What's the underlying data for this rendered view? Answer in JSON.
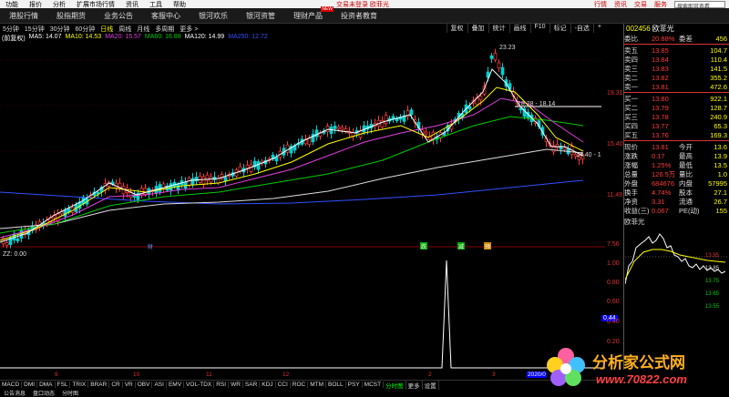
{
  "menubar": {
    "items": [
      "功能",
      "报价",
      "分析",
      "扩展市场行情",
      "资讯",
      "工具",
      "帮助"
    ],
    "warn": "交易未登录 欧菲光",
    "right": [
      "行情",
      "资讯",
      "交易",
      "服务"
    ],
    "search_placeholder": "搜索即可查看"
  },
  "nav": {
    "tabs": [
      "港股行情",
      "股指期货",
      "业务公告",
      "客服中心",
      "银河欢乐",
      "银河资管",
      "理财产品",
      "投资者教育"
    ],
    "new_badge": "NEW"
  },
  "period": {
    "items": [
      "5分钟",
      "15分钟",
      "30分钟",
      "60分钟",
      "日线",
      "周线",
      "月线",
      "多周期",
      "更多 >"
    ],
    "active": "日线",
    "right": [
      "复权",
      "叠加",
      "统计",
      "画线",
      "F10",
      "标记",
      "-自选",
      "+"
    ]
  },
  "ma": {
    "prefix": "(前复权)",
    "ma5": "MA5: 14.07",
    "ma10": "MA10: 14.53",
    "ma20": "MA20: 15.57",
    "ma60": "MA60: 16.88",
    "ma120": "MA120: 14.99",
    "ma250": "MA250: 12.72"
  },
  "chart_annotations": {
    "high": "23.23",
    "mid": "18.28 - 18.14",
    "last": "14.40 - 1",
    "zz": "ZZ: 0.00",
    "markers": [
      "财",
      "跌",
      "减",
      "预"
    ]
  },
  "yaxis": {
    "labels": [
      "19.31",
      "15.40",
      "11.49",
      "7.56",
      "1.00",
      "0.80",
      "0.60",
      "0.44",
      "0.40",
      "0.20"
    ]
  },
  "xaxis": {
    "labels": [
      "9",
      "10",
      "11",
      "12",
      "2",
      "3",
      "2020/0"
    ]
  },
  "quote": {
    "code": "002456",
    "name": "欧菲光",
    "weibi": {
      "label": "委比",
      "value": "20.88%",
      "label2": "委差",
      "value2": "456"
    },
    "asks": [
      {
        "l": "卖五",
        "p": "13.85",
        "v": "104.7"
      },
      {
        "l": "卖四",
        "p": "13.84",
        "v": "110.4"
      },
      {
        "l": "卖三",
        "p": "13.83",
        "v": "141.5"
      },
      {
        "l": "卖二",
        "p": "13.82",
        "v": "355.2"
      },
      {
        "l": "卖一",
        "p": "13.81",
        "v": "472.6"
      }
    ],
    "bids": [
      {
        "l": "买一",
        "p": "13.80",
        "v": "922.1"
      },
      {
        "l": "买二",
        "p": "13.79",
        "v": "128.7"
      },
      {
        "l": "买三",
        "p": "13.78",
        "v": "240.9"
      },
      {
        "l": "买四",
        "p": "13.77",
        "v": "65.3"
      },
      {
        "l": "买五",
        "p": "13.76",
        "v": "169.3"
      }
    ],
    "stats": [
      {
        "l": "现价",
        "v": "13.81",
        "l2": "今开",
        "v2": "13.6"
      },
      {
        "l": "涨跌",
        "v": "0.17",
        "l2": "最高",
        "v2": "13.9"
      },
      {
        "l": "涨幅",
        "v": "1.25%",
        "l2": "最低",
        "v2": "13.5"
      },
      {
        "l": "总量",
        "v": "126.5万",
        "l2": "量比",
        "v2": "1.0"
      },
      {
        "l": "外盘",
        "v": "684676",
        "l2": "内盘",
        "v2": "57995"
      },
      {
        "l": "换手",
        "v": "4.74%",
        "l2": "股本",
        "v2": "27.1"
      },
      {
        "l": "净资",
        "v": "3.31",
        "l2": "流通",
        "v2": "26.7"
      },
      {
        "l": "收益(三)",
        "v": "0.067",
        "l2": "PE(动)",
        "v2": "155"
      }
    ],
    "mini_title": "欧菲光",
    "mini_labels": [
      "13.95",
      "13.85",
      "13.75",
      "13.65",
      "13.55"
    ]
  },
  "bottombar": {
    "items": [
      "MACD",
      "DMI",
      "DMA",
      "FSL",
      "TRIX",
      "BRAR",
      "CR",
      "VR",
      "OBV",
      "ASI",
      "EMV",
      "VOL-TDX",
      "RSI",
      "WR",
      "SAR",
      "KDJ",
      "CCI",
      "ROC",
      "MTM",
      "BOLL",
      "PSY",
      "MCST",
      "分时图",
      "更多",
      "设置"
    ],
    "active": "分时图"
  },
  "bottom2": {
    "items": [
      "公告消息",
      "盘口动态",
      "分时图"
    ]
  },
  "watermark": {
    "title": "分析家公式网",
    "url": "www.70822.com"
  }
}
